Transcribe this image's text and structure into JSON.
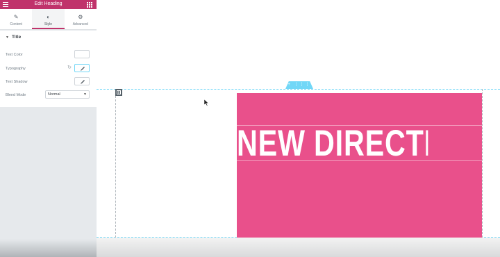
{
  "panel": {
    "title": "Edit Heading",
    "tabs": [
      {
        "label": "Content",
        "icon": "pencil-icon"
      },
      {
        "label": "Style",
        "icon": "half-circle-icon"
      },
      {
        "label": "Advanced",
        "icon": "gear-icon"
      }
    ],
    "active_tab": "Style",
    "section_title": "Title",
    "rows": {
      "text_color": "Text Color",
      "typography": "Typography",
      "text_shadow": "Text Shadow",
      "blend_mode": "Blend Mode",
      "blend_mode_value": "Normal"
    }
  },
  "canvas": {
    "heading_text": "NEW DIRECTION",
    "box_color": "#e9508b",
    "accent_color": "#c0336b",
    "outline_color": "#71d7f7",
    "section_handle_glyphs": "+ ⋮⋮⋮ ×"
  }
}
